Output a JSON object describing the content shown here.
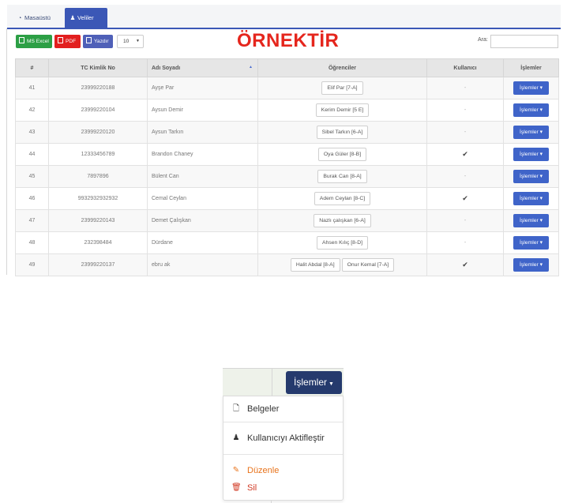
{
  "tabs": [
    {
      "label": "Masaüstü",
      "icon": "dashboard-icon"
    },
    {
      "label": "Veliler",
      "icon": "users-icon"
    }
  ],
  "toolbar": {
    "excel_label": "MS Excel",
    "pdf_label": "PDF",
    "print_label": "Yazdır",
    "page_size": "10",
    "search_label": "Ara:",
    "search_value": ""
  },
  "watermark": "ÖRNEKTİR",
  "table": {
    "headers": [
      "#",
      "TC Kimlik No",
      "Adı Soyadı",
      "Öğrenciler",
      "Kullanıcı",
      "İşlemler"
    ],
    "sorted_column": "Adı Soyadı",
    "action_label": "İşlemler ▾",
    "rows": [
      {
        "no": "41",
        "tc": "23999220188",
        "name": "Ayşe Par",
        "students": [
          "Elif Par [7-A]"
        ],
        "user": "-"
      },
      {
        "no": "42",
        "tc": "23999220104",
        "name": "Aysun Demir",
        "students": [
          "Kerim Demir [5 E]"
        ],
        "user": "-"
      },
      {
        "no": "43",
        "tc": "23999220120",
        "name": "Aysun Tarkın",
        "students": [
          "Sibel Tarkın [6-A]"
        ],
        "user": "-"
      },
      {
        "no": "44",
        "tc": "12333456789",
        "name": "Brandon Chaney",
        "students": [
          "Oya Güler [8-B]"
        ],
        "user": "✔"
      },
      {
        "no": "45",
        "tc": "7897896",
        "name": "Bülent Can",
        "students": [
          "Burak Can [8-A]"
        ],
        "user": "-"
      },
      {
        "no": "46",
        "tc": "9932932932932",
        "name": "Cemal Ceylan",
        "students": [
          "Adem Ceylan [8-C]"
        ],
        "user": "✔"
      },
      {
        "no": "47",
        "tc": "23999220143",
        "name": "Demet Çalışkan",
        "students": [
          "Nazlı çalışkan [6-A]"
        ],
        "user": "-"
      },
      {
        "no": "48",
        "tc": "232398484",
        "name": "Dürdane",
        "students": [
          "Ahsen Kılıç [8-D]"
        ],
        "user": "-"
      },
      {
        "no": "49",
        "tc": "23999220137",
        "name": "ebru ak",
        "students": [
          "Halit Abdal [8-A]",
          "Onur Kemal [7-A]"
        ],
        "user": "✔"
      }
    ]
  },
  "dropdown": {
    "button_label": "İşlemler",
    "items": [
      {
        "label": "Belgeler",
        "icon": "file-icon",
        "color": "#333333"
      },
      {
        "label": "Kullanıcıyı Aktifleştir",
        "icon": "user-icon",
        "color": "#333333"
      },
      {
        "label": "Düzenle",
        "icon": "edit-icon",
        "color": "#e8731b"
      },
      {
        "label": "Sil",
        "icon": "trash-icon",
        "color": "#d13a24"
      }
    ]
  },
  "colors": {
    "accent": "#3b57b6",
    "excel": "#2c9f45",
    "pdf": "#e21f1f",
    "print": "#4f60b8",
    "watermark": "#e5261d"
  }
}
